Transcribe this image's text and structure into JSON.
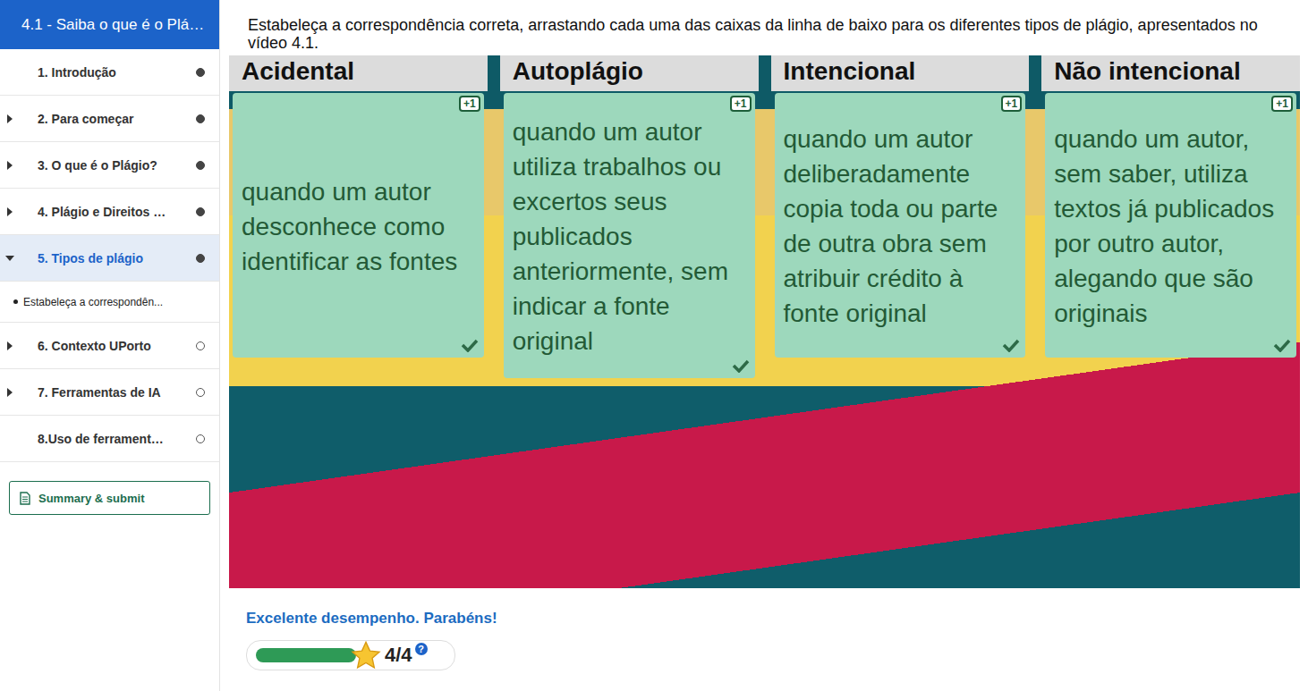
{
  "sidebar": {
    "header": "4.1 - Saiba o que é o Plá…",
    "items": [
      {
        "label": "1. Introdução",
        "kind": "item",
        "arrow": false,
        "expanded": false,
        "selected": false,
        "completed": true
      },
      {
        "label": "2. Para começar",
        "kind": "item",
        "arrow": true,
        "expanded": false,
        "selected": false,
        "completed": true
      },
      {
        "label": "3. O que é o Plágio?",
        "kind": "item",
        "arrow": true,
        "expanded": false,
        "selected": false,
        "completed": true
      },
      {
        "label": "4. Plágio e Direitos …",
        "kind": "item",
        "arrow": true,
        "expanded": false,
        "selected": false,
        "completed": true
      },
      {
        "label": "5. Tipos de plágio",
        "kind": "item",
        "arrow": true,
        "expanded": true,
        "selected": true,
        "completed": true
      },
      {
        "label": "Estabeleça a correspondên...",
        "kind": "subitem",
        "arrow": false,
        "expanded": false,
        "selected": false,
        "completed": false
      },
      {
        "label": "6. Contexto UPorto",
        "kind": "item",
        "arrow": true,
        "expanded": false,
        "selected": false,
        "completed": false
      },
      {
        "label": "7. Ferramentas de IA",
        "kind": "item",
        "arrow": true,
        "expanded": false,
        "selected": false,
        "completed": false
      },
      {
        "label": "8.Uso de ferrament…",
        "kind": "item",
        "arrow": false,
        "expanded": false,
        "selected": false,
        "completed": false
      }
    ],
    "summary_button": "Summary & submit"
  },
  "instruction": "Estabeleça a correspondência correta, arrastando cada uma das caixas da linha de baixo para os diferentes tipos de plágio, apresentados no vídeo 4.1.",
  "columns": [
    {
      "title": "Acidental",
      "text": "quando um autor desconhece como identificar as fontes",
      "badge": "+1",
      "correct": true
    },
    {
      "title": "Autoplágio",
      "text": "quando um autor utiliza trabalhos ou excertos seus publicados anteriormente, sem indicar a fonte original",
      "badge": "+1",
      "correct": true
    },
    {
      "title": "Intencional",
      "text": "quando um autor deliberadamente copia toda ou parte de outra obra sem atribuir crédito à fonte original",
      "badge": "+1",
      "correct": true
    },
    {
      "title": "Não intencional",
      "text": "quando um autor, sem saber, utiliza textos já publicados por outro autor, alegando que são originais",
      "badge": "+1",
      "correct": true
    }
  ],
  "feedback": "Excelente desempenho. Parabéns!",
  "score": {
    "text": "4/4",
    "level": 1,
    "help": "?"
  }
}
